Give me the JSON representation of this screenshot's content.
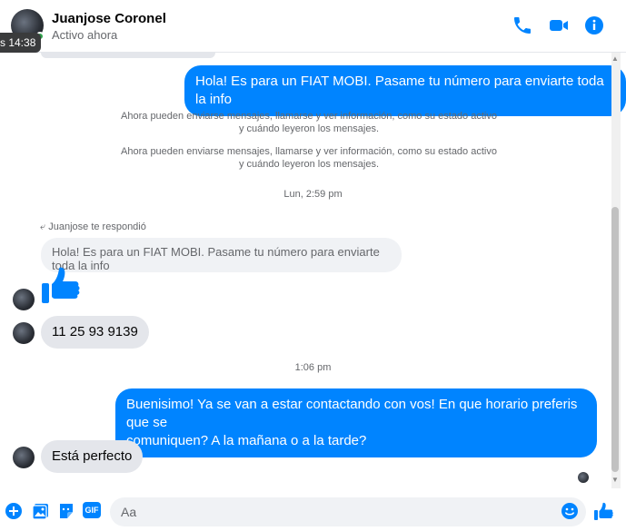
{
  "header": {
    "name": "Juanjose Coronel",
    "status": "Activo ahora",
    "hover_time": "s 14:38",
    "icons": [
      "phone-icon",
      "video-icon",
      "info-icon"
    ]
  },
  "messages": {
    "out1": "Hola! Es para un FIAT MOBI. Pasame tu número para enviarte toda la info",
    "system1_line1": "Ahora pueden enviarse mensajes, llamarse y ver información, como su estado activo",
    "system1_line2": "y cuándo leyeron los mensajes.",
    "system2_line1": "Ahora pueden enviarse mensajes, llamarse y ver información, como su estado activo",
    "system2_line2": "y cuándo leyeron los mensajes.",
    "timestamp1": "Lun, 2:59 pm",
    "reply_note": "Juanjose te respondió",
    "reply_quote": "Hola! Es para un FIAT MOBI. Pasame tu número para enviarte toda la info",
    "in_phone": "11 25 93 9139",
    "timestamp2": "1:06 pm",
    "out2_line1": "Buenisimo! Ya se van a estar contactando con vos! En que horario preferis que se",
    "out2_line2": "comuniquen? A la mañana o a la tarde?",
    "in_last": "Está perfecto"
  },
  "composer": {
    "placeholder": "Aa",
    "gif_label": "GIF"
  },
  "colors": {
    "accent": "#0084ff",
    "incoming_bubble": "#e4e6eb",
    "online": "#31a24c"
  }
}
